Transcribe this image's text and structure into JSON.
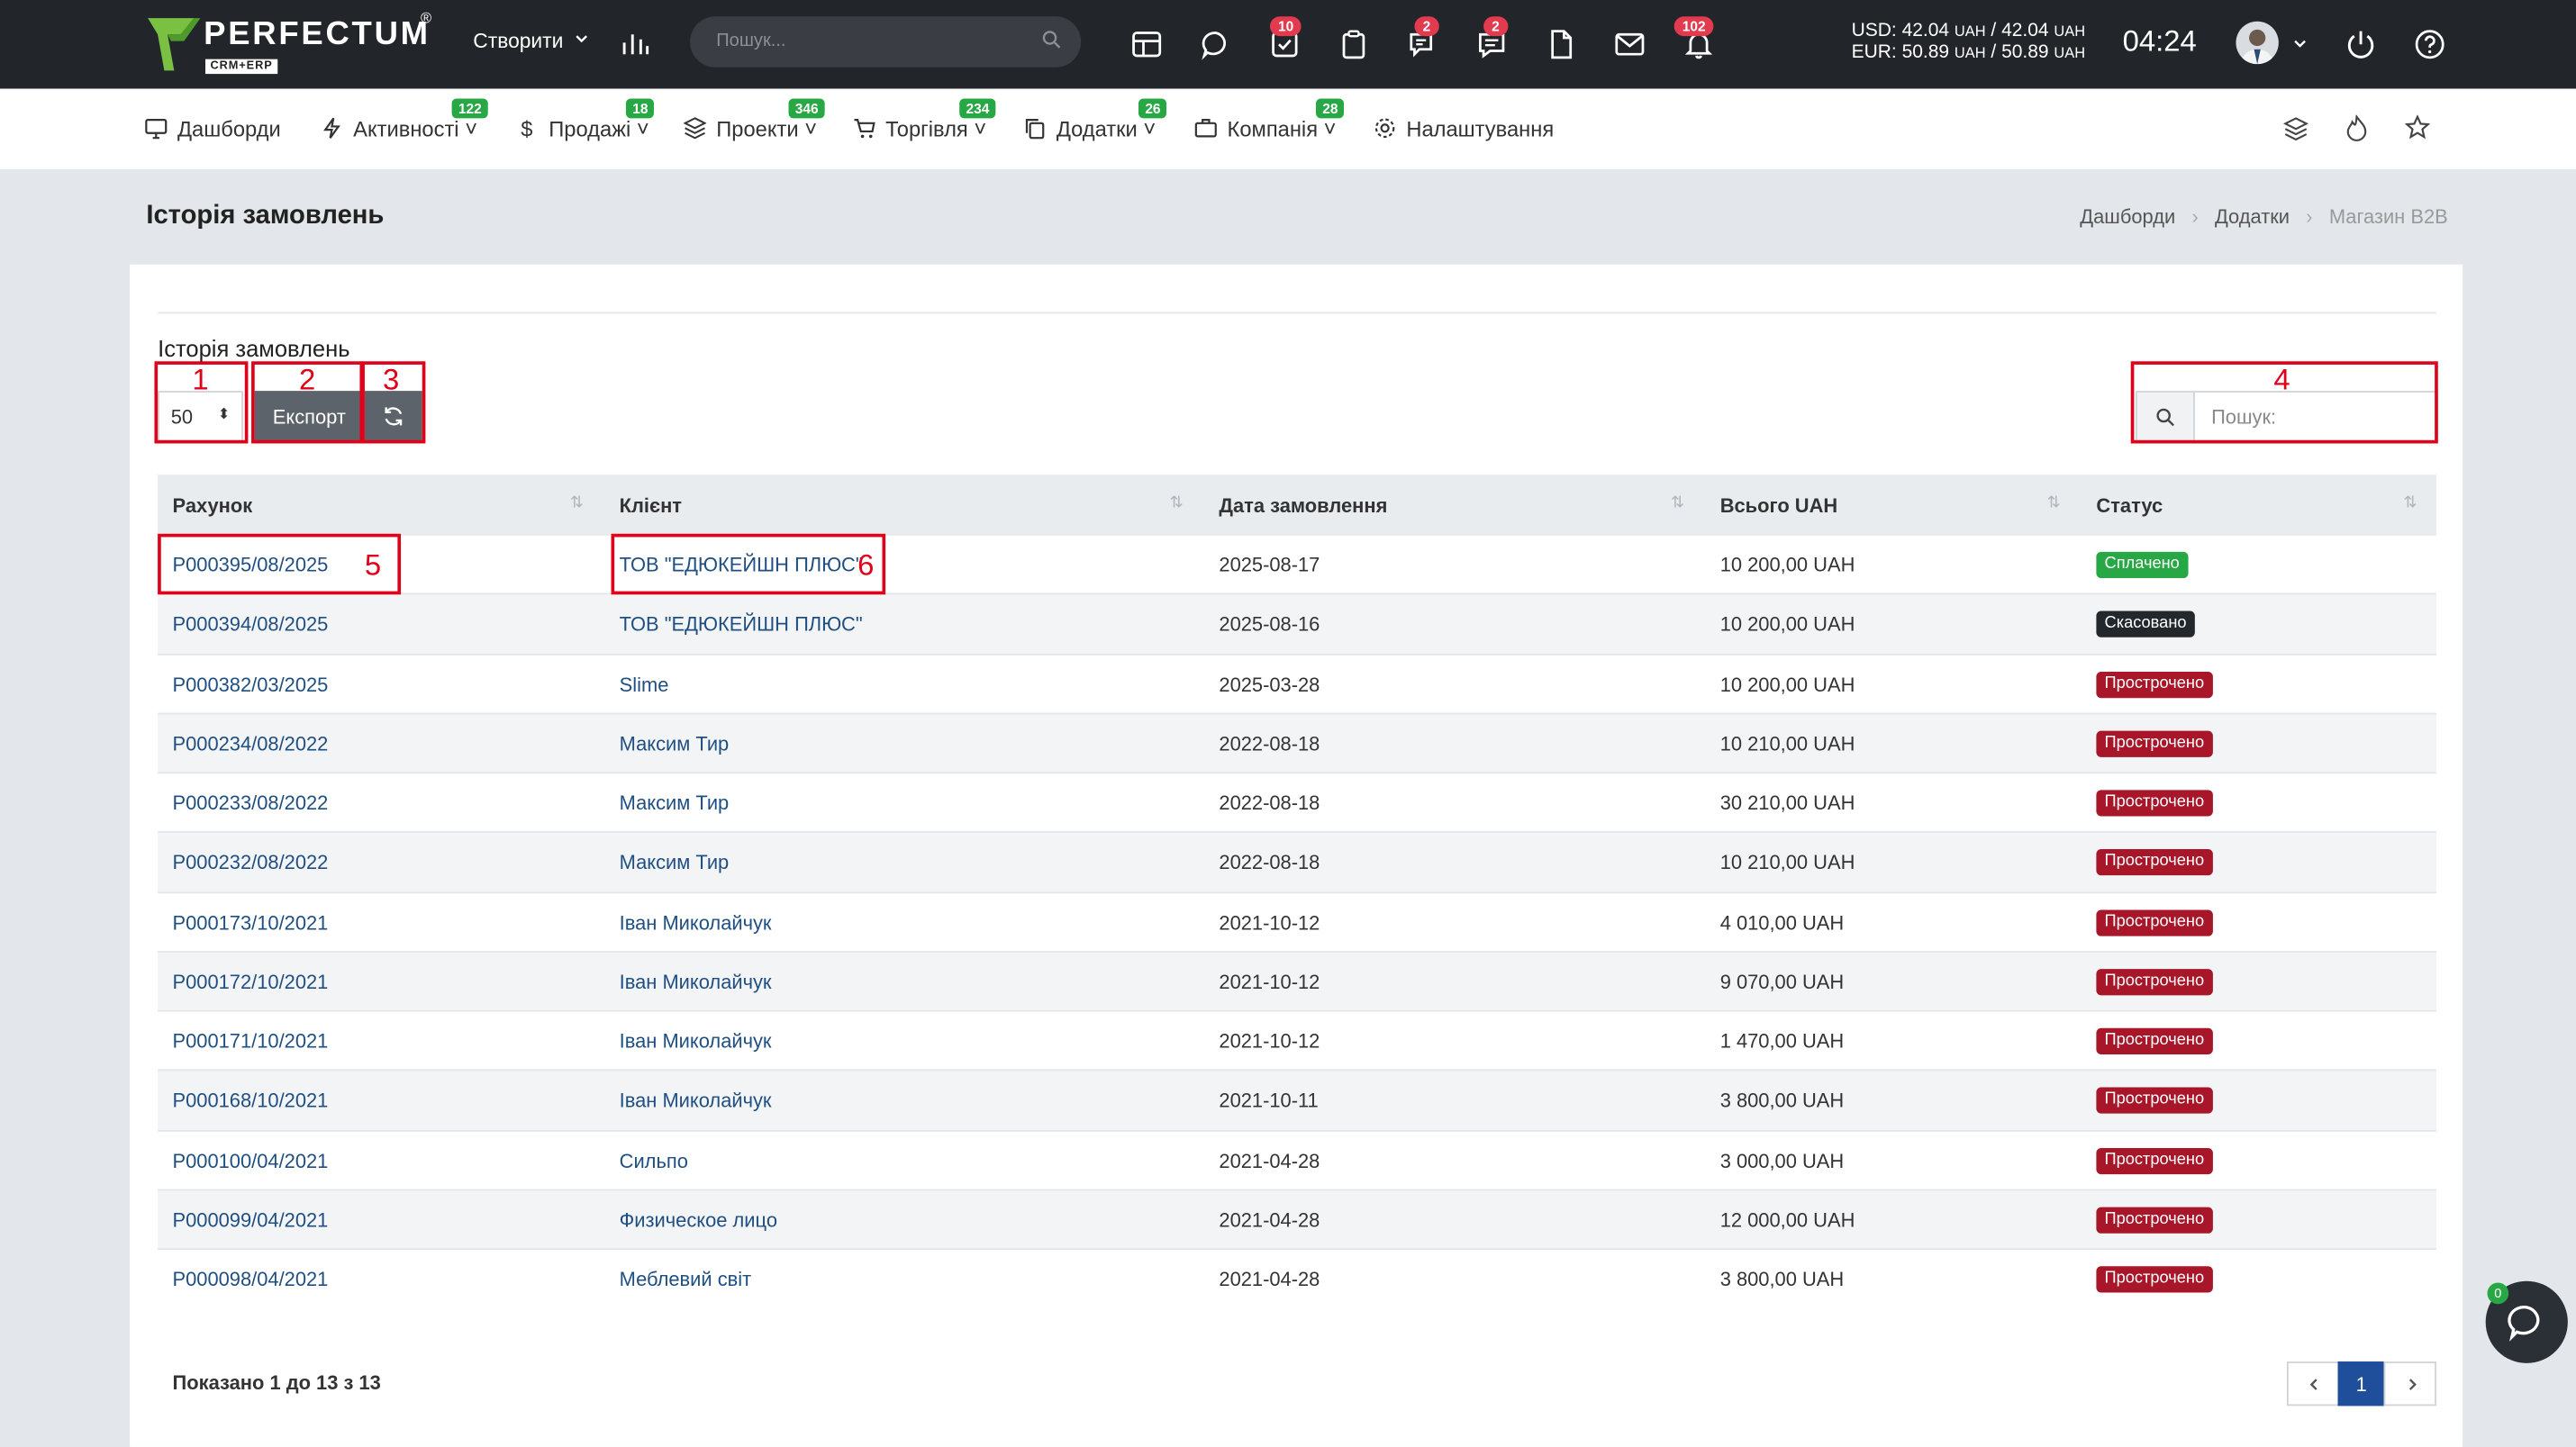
{
  "brand": {
    "name": "PERFECTUM",
    "reg": "®",
    "sub": "CRM+ERP"
  },
  "topbar": {
    "create_label": "Створити",
    "search_placeholder": "Пошук...",
    "badges": {
      "tasks": "10",
      "chat": "2",
      "messages": "2",
      "notifications": "102"
    },
    "rates": {
      "usd": "USD: 42.04",
      "usd2": "/ 42.04",
      "eur": "EUR: 50.89",
      "eur2": "/ 50.89",
      "cur": "UAH"
    },
    "time": "04:24"
  },
  "nav": {
    "dashboards": "Дашборди",
    "activities": "Активності",
    "activities_badge": "122",
    "sales": "Продажі",
    "sales_badge": "18",
    "projects": "Проекти",
    "projects_badge": "346",
    "trade": "Торгівля",
    "trade_badge": "234",
    "apps": "Додатки",
    "apps_badge": "26",
    "company": "Компанія",
    "company_badge": "28",
    "settings": "Налаштування"
  },
  "page": {
    "title": "Історія замовлень",
    "breadcrumb": [
      "Дашборди",
      "Додатки",
      "Магазин B2B"
    ]
  },
  "card": {
    "title": "Історія замовлень",
    "page_size": "50",
    "export_label": "Експорт",
    "search_placeholder": "Пошук:",
    "markers": [
      "1",
      "2",
      "3",
      "4",
      "5",
      "6"
    ]
  },
  "table": {
    "columns": [
      "Рахунок",
      "Клієнт",
      "Дата замовлення",
      "Всього UAH",
      "Статус"
    ],
    "rows": [
      [
        "P000395/08/2025",
        "ТОВ \"ЕДЮКЕЙШН ПЛЮС\"",
        "2025-08-17",
        "10 200,00 UAH",
        "Сплачено"
      ],
      [
        "P000394/08/2025",
        "ТОВ \"ЕДЮКЕЙШН ПЛЮС\"",
        "2025-08-16",
        "10 200,00 UAH",
        "Скасовано"
      ],
      [
        "P000382/03/2025",
        "Slime",
        "2025-03-28",
        "10 200,00 UAH",
        "Прострочено"
      ],
      [
        "P000234/08/2022",
        "Максим Тир",
        "2022-08-18",
        "10 210,00 UAH",
        "Прострочено"
      ],
      [
        "P000233/08/2022",
        "Максим Тир",
        "2022-08-18",
        "30 210,00 UAH",
        "Прострочено"
      ],
      [
        "P000232/08/2022",
        "Максим Тир",
        "2022-08-18",
        "10 210,00 UAH",
        "Прострочено"
      ],
      [
        "P000173/10/2021",
        "Іван Миколайчук",
        "2021-10-12",
        "4 010,00 UAH",
        "Прострочено"
      ],
      [
        "P000172/10/2021",
        "Іван Миколайчук",
        "2021-10-12",
        "9 070,00 UAH",
        "Прострочено"
      ],
      [
        "P000171/10/2021",
        "Іван Миколайчук",
        "2021-10-12",
        "1 470,00 UAH",
        "Прострочено"
      ],
      [
        "P000168/10/2021",
        "Іван Миколайчук",
        "2021-10-11",
        "3 800,00 UAH",
        "Прострочено"
      ],
      [
        "P000100/04/2021",
        "Сильпо",
        "2021-04-28",
        "3 000,00 UAH",
        "Прострочено"
      ],
      [
        "P000099/04/2021",
        "Физическое лицо",
        "2021-04-28",
        "12 000,00 UAH",
        "Прострочено"
      ],
      [
        "P000098/04/2021",
        "Меблевий світ",
        "2021-04-28",
        "3 800,00 UAH",
        "Прострочено"
      ]
    ],
    "status_colors": {
      "Сплачено": "#28a745",
      "Скасовано": "#23282d",
      "Прострочено": "#a71629"
    }
  },
  "footer": {
    "showing": "Показано 1 до 13 з 13",
    "current_page": "1",
    "chat_badge": "0"
  }
}
